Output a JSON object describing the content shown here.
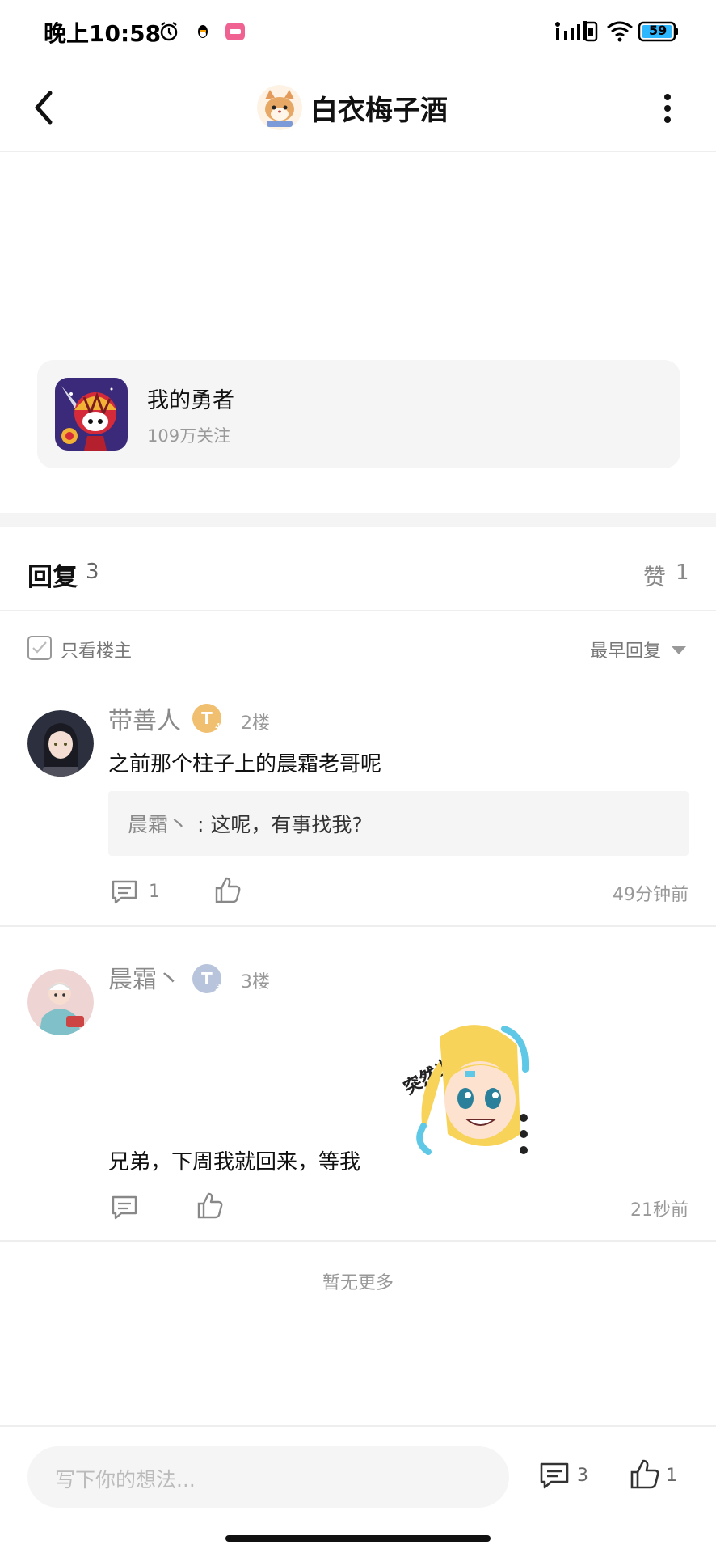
{
  "status_bar": {
    "time": "晚上10:58",
    "battery": "59",
    "icons": [
      "alarm-icon",
      "qq-icon",
      "app-icon",
      "signal-icon",
      "wifi-icon",
      "battery-icon"
    ]
  },
  "header": {
    "title": "白衣梅子酒",
    "back_icon": "chevron-left-icon",
    "more_icon": "more-vertical-icon"
  },
  "forum": {
    "name": "我的勇者",
    "followers": "109万关注"
  },
  "replies_header": {
    "title": "回复",
    "count": "3",
    "like_label": "赞",
    "like_count": "1"
  },
  "filter": {
    "only_owner": "只看楼主",
    "sort": "最早回复"
  },
  "comments": [
    {
      "user": "带善人",
      "floor": "2楼",
      "text": "之前那个柱子上的晨霜老哥呢",
      "quote_user": "晨霜丶",
      "quote_text": ": 这呢，有事找我?",
      "comment_count": "1",
      "time": "49分钟前",
      "badge": "T4"
    },
    {
      "user": "晨霜丶",
      "floor": "3楼",
      "sticker_text": "突然出现!",
      "text": "兄弟，下周我就回来，等我",
      "time": "21秒前",
      "badge": "T3"
    }
  ],
  "footer_note": "暂无更多",
  "bottom_bar": {
    "placeholder": "写下你的想法...",
    "comment_count": "3",
    "like_count": "1"
  },
  "colors": {
    "text_primary": "#111111",
    "text_secondary": "#999999",
    "card_bg": "#f5f5f5",
    "divider": "#eeeeee",
    "battery_fill": "#2db7ff",
    "badge_gold": "#f0c070",
    "badge_silver": "#b8c4dc"
  }
}
